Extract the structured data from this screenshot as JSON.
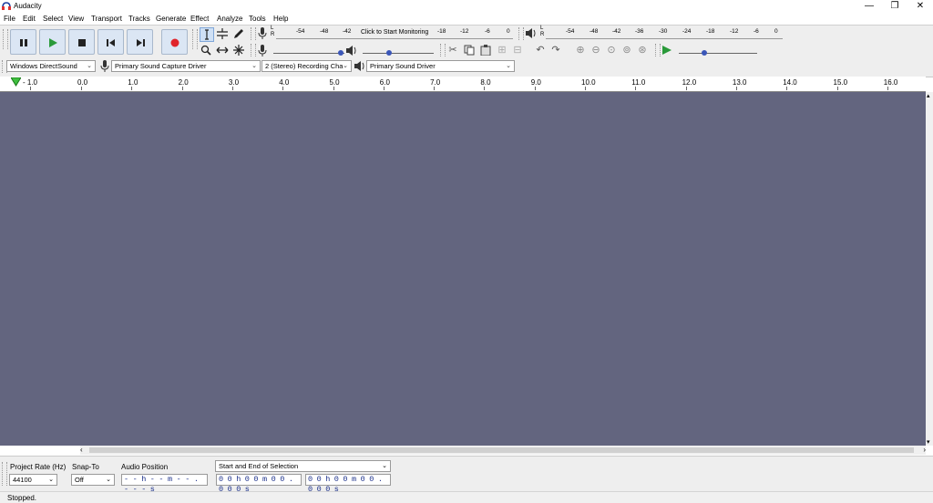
{
  "window": {
    "title": "Audacity",
    "minimize": "—",
    "restore": "❐",
    "close": "✕"
  },
  "menu": [
    "File",
    "Edit",
    "Select",
    "View",
    "Transport",
    "Tracks",
    "Generate",
    "Effect",
    "Analyze",
    "Tools",
    "Help"
  ],
  "meters": {
    "record_prompt": "Click to Start Monitoring",
    "record_scale": [
      "-54",
      "-48",
      "-42",
      "-18",
      "-12",
      "-6",
      "0"
    ],
    "playback_scale": [
      "-54",
      "-48",
      "-42",
      "-36",
      "-30",
      "-24",
      "-18",
      "-12",
      "-6",
      "0"
    ],
    "channel_l": "L",
    "channel_r": "R"
  },
  "device": {
    "host": "Windows DirectSound",
    "recording_device": "Primary Sound Capture Driver",
    "channels": "2 (Stereo) Recording Cha",
    "playback_device": "Primary Sound Driver"
  },
  "ruler": [
    "- 1.0",
    "0.0",
    "1.0",
    "2.0",
    "3.0",
    "4.0",
    "5.0",
    "6.0",
    "7.0",
    "8.0",
    "9.0",
    "10.0",
    "11.0",
    "12.0",
    "13.0",
    "14.0",
    "15.0",
    "16.0"
  ],
  "selection": {
    "project_rate_label": "Project Rate (Hz)",
    "project_rate": "44100",
    "snap_to_label": "Snap-To",
    "snap_to": "Off",
    "audio_position_label": "Audio Position",
    "audio_position": "- - h - - m - - . - - - s",
    "selection_mode": "Start and End of Selection",
    "start_time": "0 0 h 0 0 m 0 0 . 0 0 0 s",
    "end_time": "0 0 h 0 0 m 0 0 . 0 0 0 s"
  },
  "status": "Stopped.",
  "colors": {
    "track_bg": "#63657f",
    "record": "#e0242b",
    "play": "#2a9a3a",
    "accent": "#3a56b8"
  }
}
